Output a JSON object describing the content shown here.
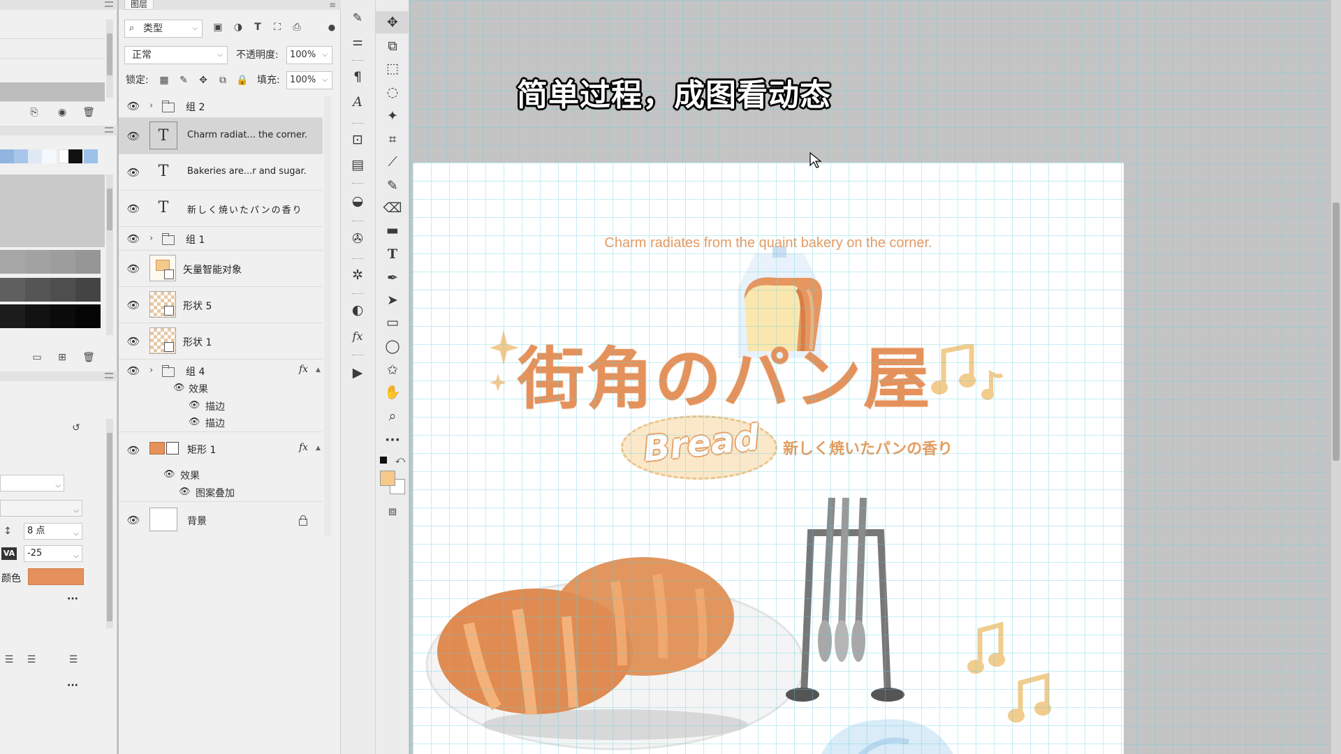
{
  "layers_panel": {
    "tab_title": "图层",
    "filter_label": "类型",
    "blend_mode": "正常",
    "opacity_label": "不透明度:",
    "opacity_value": "100%",
    "lock_label": "锁定:",
    "fill_label": "填充:",
    "fill_value": "100%",
    "layers": [
      {
        "name": "组 2"
      },
      {
        "name": "Charm radiat... the corner."
      },
      {
        "name": "Bakeries are...r and sugar."
      },
      {
        "name": "新しく焼いたパンの香り"
      },
      {
        "name": "组 1"
      },
      {
        "name": "矢量智能对象"
      },
      {
        "name": "形状 5"
      },
      {
        "name": "形状 1"
      },
      {
        "name": "组 4",
        "effects_label": "效果",
        "effects": [
          "描边",
          "描边"
        ]
      },
      {
        "name": "矩形 1",
        "effects_label": "效果",
        "effects": [
          "图案叠加"
        ]
      },
      {
        "name": "背景"
      }
    ],
    "fx_label": "fx"
  },
  "character_panel": {
    "leading_value": "8 点",
    "tracking_value": "-25",
    "color_label": "颜色",
    "color_value": "#e5915b",
    "more_label": "···"
  },
  "colors": {
    "foreground": "#f5c98a",
    "accent_orange": "#e5915b",
    "swatches": [
      "#8fb5e0",
      "#a9c6ea",
      "#dfe9f6",
      "#ffffff",
      "#111111",
      "#9cc1ea"
    ]
  },
  "canvas": {
    "subtitle_overlay": "简单过程，成图看动态",
    "tagline": "Charm radiates from the quaint bakery on the corner.",
    "main_title": "街角のパン屋",
    "badge_word": "Bread",
    "badge_caption": "新しく焼いたパンの香り"
  }
}
